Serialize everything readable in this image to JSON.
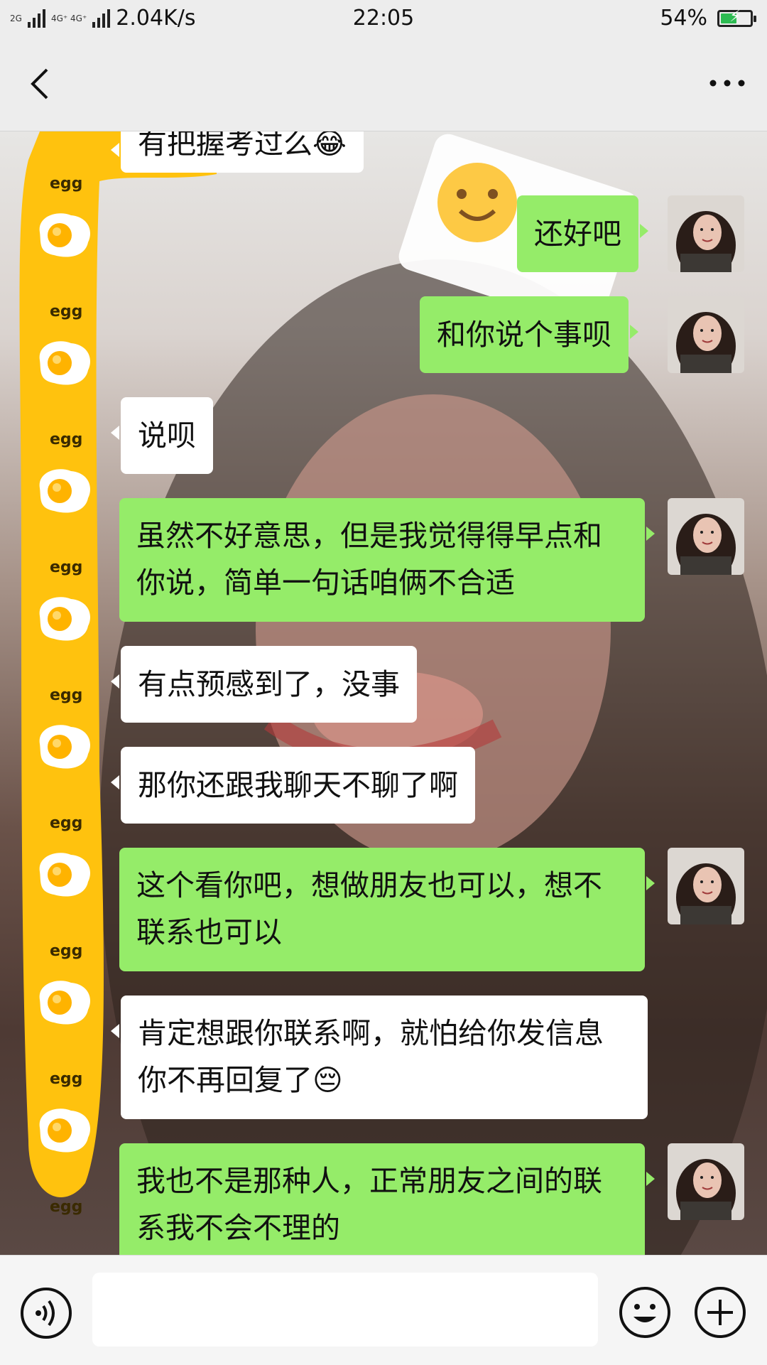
{
  "status_bar": {
    "network_1": "2G",
    "network_2": "4G⁺ 4G⁺",
    "speed": "2.04K/s",
    "time": "22:05",
    "battery_percent": "54%",
    "battery_level": 0.54
  },
  "title_bar": {
    "back_icon": "chevron-left-icon",
    "more_icon": "more-dots-icon"
  },
  "messages": [
    {
      "side": "in",
      "text": "有把握考过么😂"
    },
    {
      "side": "out",
      "text": "还好吧"
    },
    {
      "side": "out",
      "text": "和你说个事呗"
    },
    {
      "side": "in",
      "text": "说呗"
    },
    {
      "side": "out",
      "text": "虽然不好意思，但是我觉得得早点和你说，简单一句话咱俩不合适"
    },
    {
      "side": "in",
      "text": "有点预感到了，没事"
    },
    {
      "side": "in",
      "text": "那你还跟我聊天不聊了啊"
    },
    {
      "side": "out",
      "text": "这个看你吧，想做朋友也可以，想不联系也可以"
    },
    {
      "side": "in",
      "text": "肯定想跟你联系啊，就怕给你发信息你不再回复了😔"
    },
    {
      "side": "out",
      "text": "我也不是那种人，正常朋友之间的联系我不会不理的"
    }
  ],
  "decoration": {
    "egg_label": "egg"
  },
  "input_bar": {
    "voice_icon": "voice-icon",
    "input_value": "",
    "emoji_icon": "smile-icon",
    "plus_icon": "plus-icon"
  },
  "colors": {
    "outgoing_bubble": "#95ec69",
    "incoming_bubble": "#ffffff",
    "bar_bg": "#ededed",
    "egg_yellow": "#ffc20e"
  }
}
